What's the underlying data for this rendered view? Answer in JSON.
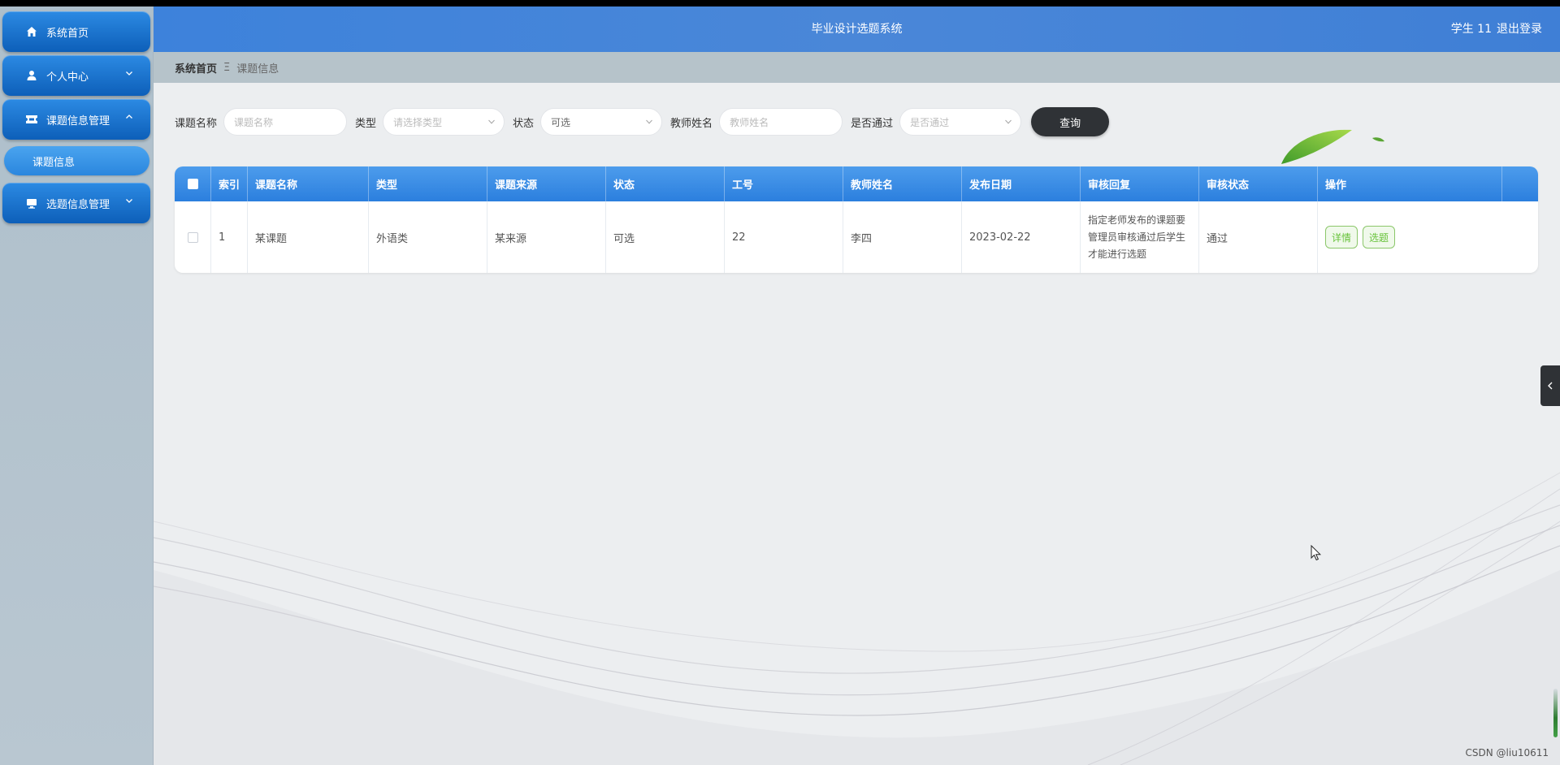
{
  "sidebar": {
    "items": [
      {
        "label": "系统首页",
        "icon": "home-icon"
      },
      {
        "label": "个人中心",
        "icon": "user-icon"
      },
      {
        "label": "课题信息管理",
        "icon": "ticket-icon"
      },
      {
        "label": "选题信息管理",
        "icon": "monitor-icon"
      }
    ],
    "sub_items": [
      {
        "label": "课题信息"
      }
    ]
  },
  "header": {
    "title": "毕业设计选题系统",
    "user": "学生 11",
    "logout": "退出登录"
  },
  "breadcrumb": {
    "home": "系统首页",
    "separator": "Ξ",
    "current": "课题信息"
  },
  "search": {
    "topic_name_label": "课题名称",
    "topic_name_placeholder": "课题名称",
    "type_label": "类型",
    "type_placeholder": "请选择类型",
    "status_label": "状态",
    "status_value": "可选",
    "teacher_label": "教师姓名",
    "teacher_placeholder": "教师姓名",
    "approved_label": "是否通过",
    "approved_placeholder": "是否通过",
    "query_label": "查询"
  },
  "table": {
    "headers": [
      "索引",
      "课题名称",
      "类型",
      "课题来源",
      "状态",
      "工号",
      "教师姓名",
      "发布日期",
      "审核回复",
      "审核状态",
      "操作"
    ],
    "rows": [
      {
        "index": "1",
        "name": "某课题",
        "type": "外语类",
        "source": "某来源",
        "status": "可选",
        "job_no": "22",
        "teacher": "李四",
        "date": "2023-02-22",
        "review_reply": "指定老师发布的课题要管理员审核通过后学生才能进行选题",
        "review_status": "通过",
        "actions": [
          "详情",
          "选题"
        ]
      }
    ]
  },
  "watermark": "CSDN @liu10611",
  "colors": {
    "header": "#3d82db",
    "sidebar_button": "#1470cc",
    "query_button": "#2f3236",
    "action_button": "#67c23a"
  }
}
